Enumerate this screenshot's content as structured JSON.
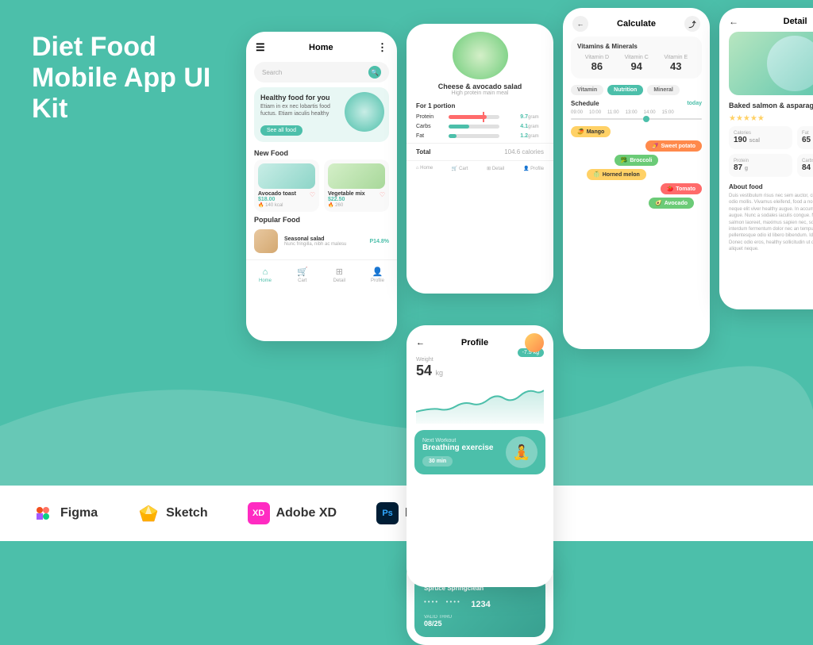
{
  "title": {
    "line1": "Diet Food",
    "line2": "Mobile App UI Kit"
  },
  "tools": [
    {
      "name": "Figma",
      "icon": "figma"
    },
    {
      "name": "Sketch",
      "icon": "sketch"
    },
    {
      "name": "Adobe XD",
      "icon": "xd",
      "prefix": "XD"
    },
    {
      "name": "Photoshop",
      "icon": "ps",
      "prefix": "Ps"
    }
  ],
  "screen_home": {
    "title": "Home",
    "search_placeholder": "Search",
    "hero": {
      "title": "Healthy food for you",
      "desc": "Etiam in ex nec lobartis food fuctus. Etiam iaculis healthy",
      "btn": "See all food"
    },
    "new_food_label": "New Food",
    "foods": [
      {
        "name": "Avocado toast",
        "price": "$18.00",
        "cal": "140 kcal"
      },
      {
        "name": "Vegetable mix",
        "price": "$22.50",
        "cal": "260"
      }
    ],
    "popular_label": "Popular Food",
    "popular_items": [
      {
        "name": "Seasonal salad",
        "desc": "Nunc fringilla, nibh ac malesu",
        "price": "P14.8%"
      }
    ],
    "nav": [
      "Home",
      "Cart",
      "Detail",
      "Profile"
    ]
  },
  "screen_calculate": {
    "title": "Calculate",
    "vitamins_title": "Vitamins & Minerals",
    "vitamins": [
      {
        "name": "Vitamin D",
        "value": "86"
      },
      {
        "name": "Vitamin C",
        "value": "94"
      },
      {
        "name": "Vitamin E",
        "value": "43"
      }
    ],
    "tabs": [
      "Vitamin",
      "Nutrition",
      "Mineral"
    ],
    "active_tab": "Nutrition",
    "schedule_title": "Schedule",
    "today": "today",
    "times": [
      "09:00",
      "10:00",
      "11:00",
      "12:00",
      "13:00",
      "14:00",
      "15:00"
    ],
    "items": [
      "Mango",
      "Sweet potato",
      "Broccoli",
      "Horned melon",
      "Tomato",
      "Avocado"
    ]
  },
  "screen_nutrition": {
    "food_name": "Cheese & avocado salad",
    "food_sub": "High protein main meal",
    "portion_label": "For 1 portion",
    "nutrients": [
      {
        "label": "Protein",
        "value": "9.7",
        "unit": "gram",
        "pct": 75
      },
      {
        "label": "Carbs",
        "value": "4.1",
        "unit": "gram",
        "pct": 40
      },
      {
        "label": "Fat",
        "value": "1.2",
        "unit": "gram",
        "pct": 15
      }
    ],
    "total_label": "Total",
    "total_value": "104.6 calories",
    "nav": [
      "Home",
      "Cart",
      "Detail",
      "Profile"
    ]
  },
  "screen_profile": {
    "title": "Profile",
    "weight_label": "Weight",
    "weight_value": "54",
    "weight_unit": "kg",
    "change": "-7.5 kg",
    "workout": {
      "label": "Next Workout",
      "title": "Breathing exercise",
      "duration": "30 min"
    }
  },
  "screen_payment": {
    "bank": "Spruce Springclean",
    "dots": "•••• •••• •••• 1234",
    "valid_label": "VALID THRU",
    "valid_date": "08/25"
  },
  "screen_detail": {
    "title": "Detail",
    "food_name": "Baked salmon & asparagus",
    "stars": 5,
    "nutrition": [
      {
        "label": "Calories",
        "value": "190",
        "unit": "scal"
      },
      {
        "label": "Fat",
        "value": "65",
        "unit": "g"
      },
      {
        "label": "Protein",
        "value": "87",
        "unit": "g"
      },
      {
        "label": "Carbs",
        "value": "84",
        "unit": "g"
      }
    ],
    "about_title": "About food",
    "about_text": "Duis vestibulum risus nec sem auctor, cita amet fermentum odio mollis. Vivamus eleifend, food a non volutpat venenatis, neque elit viver healthy augue. In accumsan orci diam et augue. Nunc a sodales iaculis congue. Nullam vita food salmon laoreet, maximus sapien nec, sollicitudin dolor. Nunc interdum fermentum dolor nec an tempus. Nullam pellentesque odio id libero bibendum. Id sagittis leo vulputate. Donec odio eros, healthy sollicitudin ut quam ut, suscipit aliquet neque."
  }
}
